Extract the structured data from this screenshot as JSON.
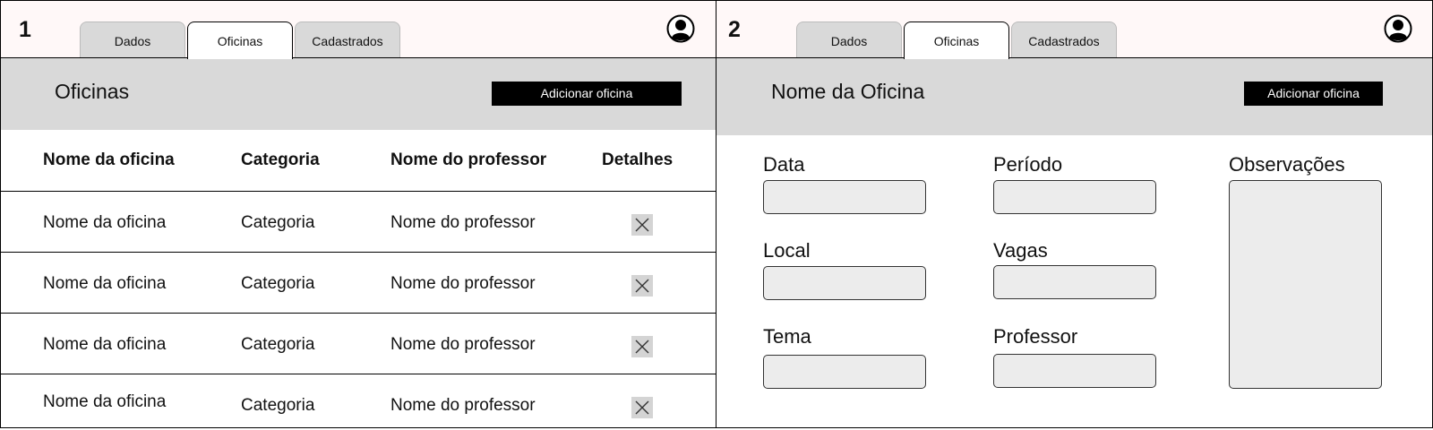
{
  "frames": [
    {
      "number": "1",
      "tabs": [
        "Dados",
        "Oficinas",
        "Cadastrados"
      ],
      "active_tab": "Oficinas",
      "title": "Oficinas",
      "add_button": "Adicionar oficina",
      "table": {
        "headers": [
          "Nome da oficina",
          "Categoria",
          "Nome do professor",
          "Detalhes"
        ],
        "rows": [
          [
            "Nome da oficina",
            "Categoria",
            "Nome do professor"
          ],
          [
            "Nome da oficina",
            "Categoria",
            "Nome do professor"
          ],
          [
            "Nome da oficina",
            "Categoria",
            "Nome do professor"
          ],
          [
            "Nome da oficina",
            "Categoria",
            "Nome do professor"
          ]
        ],
        "row_icon": "close-icon"
      }
    },
    {
      "number": "2",
      "tabs": [
        "Dados",
        "Oficinas",
        "Cadastrados"
      ],
      "active_tab": "Oficinas",
      "title": "Nome da Oficina",
      "add_button": "Adicionar oficina",
      "form": {
        "data": "Data",
        "periodo": "Período",
        "observacoes": "Observações",
        "local": "Local",
        "vagas": "Vagas",
        "tema": "Tema",
        "professor": "Professor"
      }
    }
  ],
  "icons": {
    "avatar": "user-avatar-icon",
    "row_close": "close-icon"
  },
  "colors": {
    "topbar": "#fff8f8",
    "subheader": "#d9d9d9",
    "button": "#000000",
    "input": "#ececec"
  }
}
